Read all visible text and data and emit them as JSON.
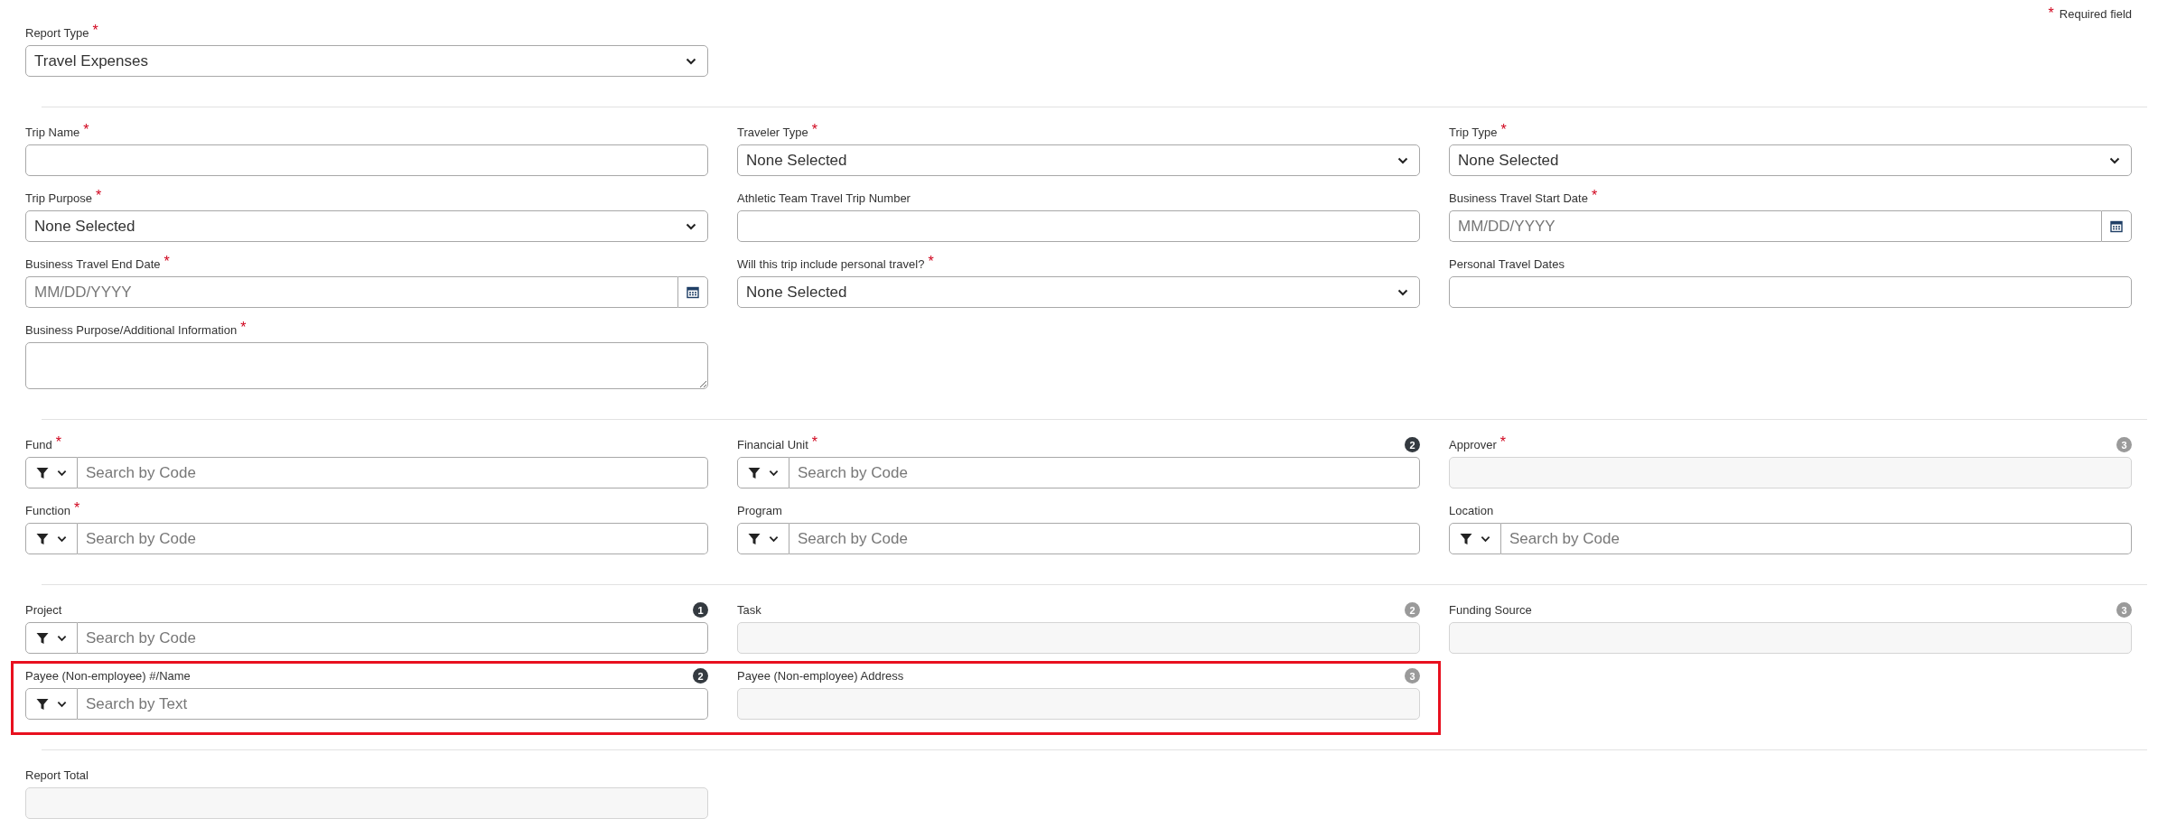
{
  "required_note": {
    "marker": "*",
    "text": "Required field"
  },
  "sections": [
    {
      "rows": [
        {
          "highlighted": false,
          "fields": [
            {
              "label": "Report Type",
              "required_mark": "*",
              "kind": "select",
              "value": "Travel Expenses"
            }
          ]
        }
      ]
    },
    {
      "rows": [
        {
          "highlighted": false,
          "fields": [
            {
              "label": "Trip Name",
              "required_mark": "*",
              "kind": "text"
            },
            {
              "label": "Traveler Type",
              "required_mark": "*",
              "kind": "select",
              "value": "None Selected"
            },
            {
              "label": "Trip Type",
              "required_mark": "*",
              "kind": "select",
              "value": "None Selected"
            }
          ]
        },
        {
          "highlighted": false,
          "fields": [
            {
              "label": "Trip Purpose",
              "required_mark": "*",
              "kind": "select",
              "value": "None Selected"
            },
            {
              "label": "Athletic Team Travel Trip Number",
              "kind": "text"
            },
            {
              "label": "Business Travel Start Date",
              "required_mark": "*",
              "kind": "date",
              "placeholder": "MM/DD/YYYY"
            }
          ]
        },
        {
          "highlighted": false,
          "fields": [
            {
              "label": "Business Travel End Date",
              "required_mark": "*",
              "kind": "date",
              "placeholder": "MM/DD/YYYY"
            },
            {
              "label": "Will this trip include personal travel?",
              "required_mark": "*",
              "kind": "select",
              "value": "None Selected"
            },
            {
              "label": "Personal Travel Dates",
              "kind": "text"
            }
          ]
        },
        {
          "highlighted": false,
          "fields": [
            {
              "label": "Business Purpose/Additional Information",
              "required_mark": "*",
              "kind": "textarea"
            }
          ]
        }
      ]
    },
    {
      "rows": [
        {
          "highlighted": false,
          "fields": [
            {
              "label": "Fund",
              "required_mark": "*",
              "kind": "lookup",
              "placeholder": "Search by Code"
            },
            {
              "label": "Financial Unit",
              "required_mark": "*",
              "kind": "lookup",
              "placeholder": "Search by Code",
              "badge": {
                "text": "2",
                "color": "#343a40"
              }
            },
            {
              "label": "Approver",
              "required_mark": "*",
              "kind": "readonly",
              "badge": {
                "text": "3",
                "color": "#9a9a9a"
              }
            }
          ]
        },
        {
          "highlighted": false,
          "fields": [
            {
              "label": "Function",
              "required_mark": "*",
              "kind": "lookup",
              "placeholder": "Search by Code"
            },
            {
              "label": "Program",
              "kind": "lookup",
              "placeholder": "Search by Code"
            },
            {
              "label": "Location",
              "kind": "lookup",
              "placeholder": "Search by Code"
            }
          ]
        }
      ]
    },
    {
      "rows": [
        {
          "highlighted": false,
          "fields": [
            {
              "label": "Project",
              "kind": "lookup",
              "placeholder": "Search by Code",
              "badge": {
                "text": "1",
                "color": "#343a40"
              }
            },
            {
              "label": "Task",
              "kind": "readonly",
              "badge": {
                "text": "2",
                "color": "#9a9a9a"
              }
            },
            {
              "label": "Funding Source",
              "kind": "readonly",
              "badge": {
                "text": "3",
                "color": "#9a9a9a"
              }
            }
          ]
        },
        {
          "highlighted": true,
          "fields": [
            {
              "label": "Payee (Non-employee) #/Name",
              "kind": "lookup",
              "placeholder": "Search by Text",
              "badge": {
                "text": "2",
                "color": "#343a40"
              }
            },
            {
              "label": "Payee (Non-employee) Address",
              "kind": "readonly",
              "badge": {
                "text": "3",
                "color": "#9a9a9a"
              }
            }
          ]
        }
      ]
    },
    {
      "rows": [
        {
          "highlighted": false,
          "fields": [
            {
              "label": "Report Total",
              "kind": "readonly"
            }
          ]
        }
      ]
    }
  ]
}
